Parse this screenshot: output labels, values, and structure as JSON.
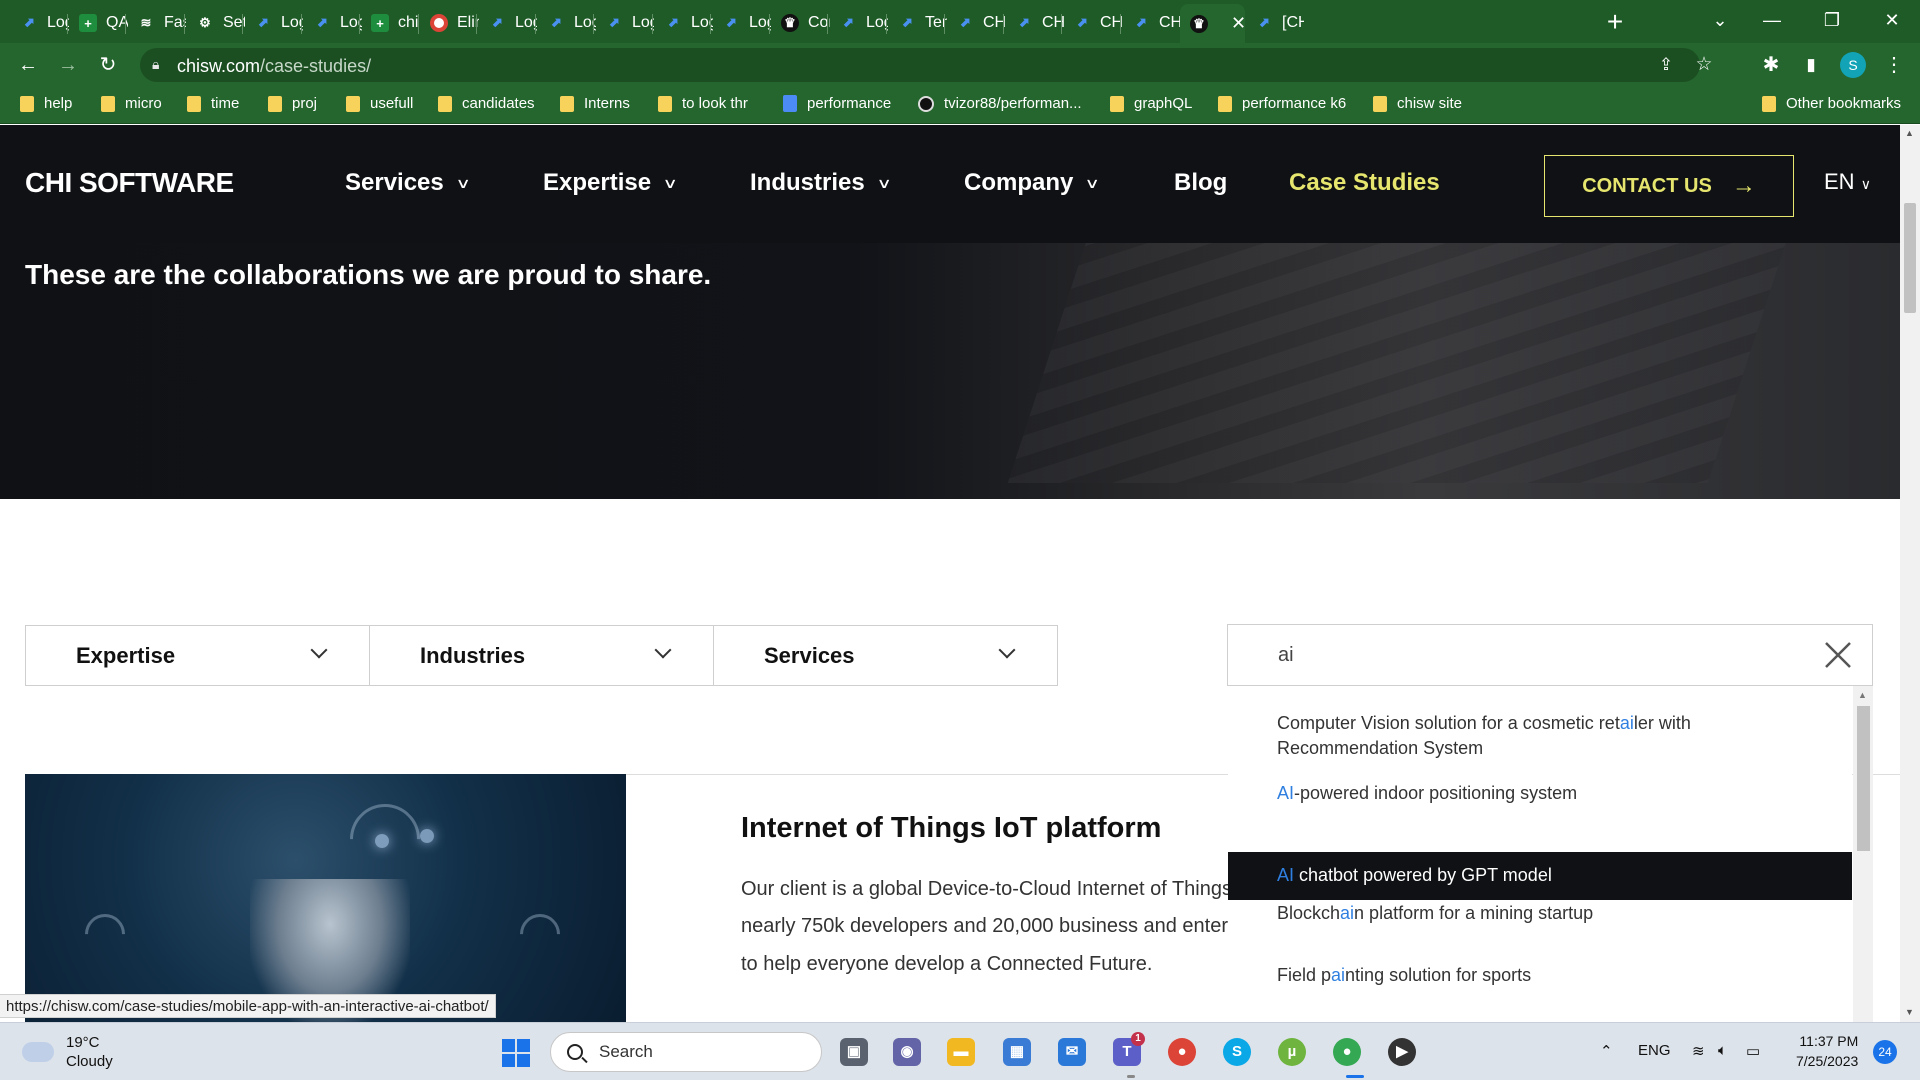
{
  "browser": {
    "tabs": [
      {
        "title": "Log",
        "icon": "jira-icon"
      },
      {
        "title": "QA",
        "icon": "sheets-icon"
      },
      {
        "title": "Fas",
        "icon": "stack-icon"
      },
      {
        "title": "Set",
        "icon": "gear-icon"
      },
      {
        "title": "Log",
        "icon": "jira-icon"
      },
      {
        "title": "Log",
        "icon": "jira-icon"
      },
      {
        "title": "chi",
        "icon": "sheets-icon"
      },
      {
        "title": "Elin",
        "icon": "chrome-icon"
      },
      {
        "title": "Log",
        "icon": "jira-icon"
      },
      {
        "title": "Log",
        "icon": "jira-icon"
      },
      {
        "title": "Log",
        "icon": "jira-icon"
      },
      {
        "title": "Log",
        "icon": "jira-icon"
      },
      {
        "title": "Log",
        "icon": "jira-icon"
      },
      {
        "title": "Cor",
        "icon": "chi-icon"
      },
      {
        "title": "Log",
        "icon": "jira-icon"
      },
      {
        "title": "Ten",
        "icon": "jira-icon"
      },
      {
        "title": "CH",
        "icon": "jira-icon"
      },
      {
        "title": "CH",
        "icon": "jira-icon"
      },
      {
        "title": "CH",
        "icon": "jira-icon"
      },
      {
        "title": "CH",
        "icon": "jira-icon"
      },
      {
        "title": "",
        "icon": "chi-icon",
        "active": true
      },
      {
        "title": "[CH",
        "icon": "jira-icon"
      }
    ],
    "url_host": "chisw.com",
    "url_path": "/case-studies/",
    "profile_initial": "S",
    "bookmarks": [
      {
        "label": "help",
        "type": "folder"
      },
      {
        "label": "micro",
        "type": "folder"
      },
      {
        "label": "time",
        "type": "folder"
      },
      {
        "label": "proj",
        "type": "folder"
      },
      {
        "label": "usefull",
        "type": "folder"
      },
      {
        "label": "candidates",
        "type": "folder"
      },
      {
        "label": "Interns",
        "type": "folder"
      },
      {
        "label": "to look thr",
        "type": "folder"
      },
      {
        "label": "performance",
        "type": "doc"
      },
      {
        "label": "tvizor88/performan...",
        "type": "github"
      },
      {
        "label": "graphQL",
        "type": "folder"
      },
      {
        "label": "performance k6",
        "type": "folder"
      },
      {
        "label": "chisw site",
        "type": "folder"
      }
    ],
    "other_bookmarks": "Other bookmarks",
    "status_url": "https://chisw.com/case-studies/mobile-app-with-an-interactive-ai-chatbot/"
  },
  "site": {
    "logo": "CHI SOFTWARE",
    "nav": [
      "Services",
      "Expertise",
      "Industries",
      "Company",
      "Blog",
      "Case Studies"
    ],
    "contact": "CONTACT US",
    "lang": "EN",
    "hero_text": "These are the collaborations we are proud to share.",
    "filters": [
      "Expertise",
      "Industries",
      "Services"
    ],
    "search_value": "ai",
    "results": [
      {
        "before": "Computer Vision solution for a cosmetic ret",
        "match": "ai",
        "after": "ler with",
        "line2": "Recommendation System"
      },
      {
        "before": "",
        "match": "AI",
        "after": "-powered indoor positioning system"
      },
      {
        "before": "",
        "match": "AI",
        "after": " chatbot powered by GPT model",
        "selected": true
      },
      {
        "before": "Blockch",
        "match": "ai",
        "after": "n platform for a mining startup"
      },
      {
        "before": "Field p",
        "match": "ai",
        "after": "nting solution for sports"
      }
    ],
    "card": {
      "title": "Internet of Things IoT platform",
      "lines": [
        "Our client is a global Device-to-Cloud Internet of Things",
        "nearly 750k developers and 20,000 business and enter",
        "to help everyone develop a Connected Future."
      ]
    }
  },
  "taskbar": {
    "temp": "19°C",
    "weather": "Cloudy",
    "search": "Search",
    "lang": "ENG",
    "time": "11:37 PM",
    "date": "7/25/2023",
    "notifications": "24",
    "teams_badge": "1"
  },
  "colors": {
    "chrome_green": "#24662d",
    "site_dark": "#0f1114",
    "accent_yellow": "#e6e56e",
    "highlight_blue": "#2f7fe0"
  }
}
